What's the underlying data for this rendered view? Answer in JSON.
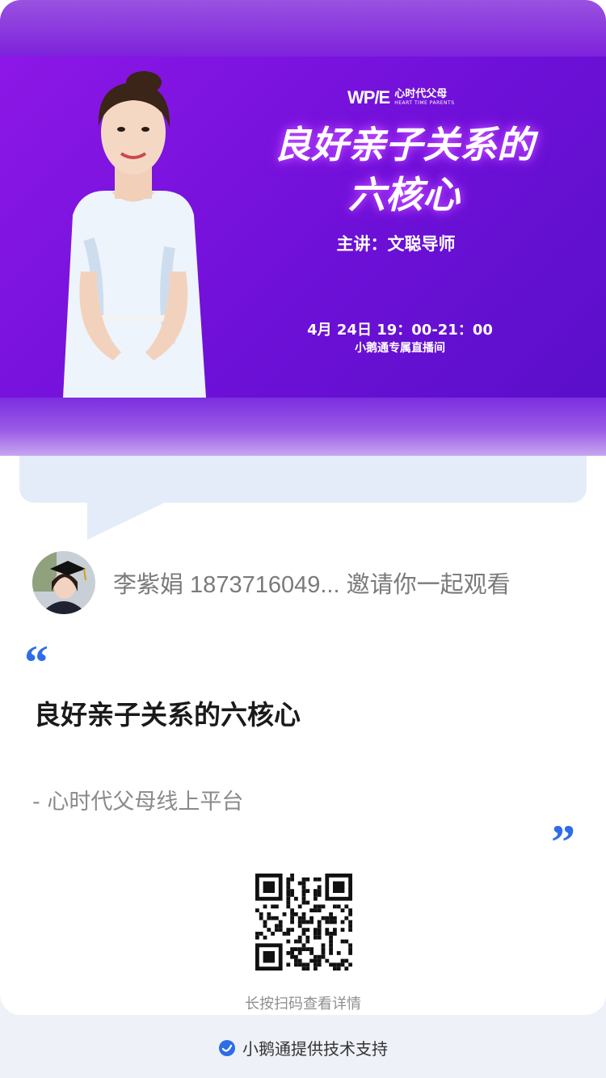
{
  "banner": {
    "logo_mark": "WP/E",
    "logo_cn": "心时代父母",
    "logo_en": "HEART TIME PARENTS",
    "title_line1": "良好亲子关系的",
    "title_line2": "六核心",
    "speaker": "主讲：文聪导师",
    "datetime": "4月 24日  19：00-21：00",
    "room": "小鹅通专属直播间"
  },
  "invite": {
    "text": "李紫娟 1873716049... 邀请你一起观看"
  },
  "content": {
    "quote_open": "“",
    "course_title": "良好亲子关系的六核心",
    "source": "- 心时代父母线上平台",
    "quote_close": "”"
  },
  "qr_hint": "长按扫码查看详情",
  "footer": {
    "text": "小鹅通提供技术支持",
    "icon": "xiaoetong-logo-icon"
  },
  "colors": {
    "banner_purple": "#7a14dc",
    "accent_blue": "#2e6de8",
    "bubble": "#e4ecfa",
    "page_bg": "#eef1f7"
  }
}
